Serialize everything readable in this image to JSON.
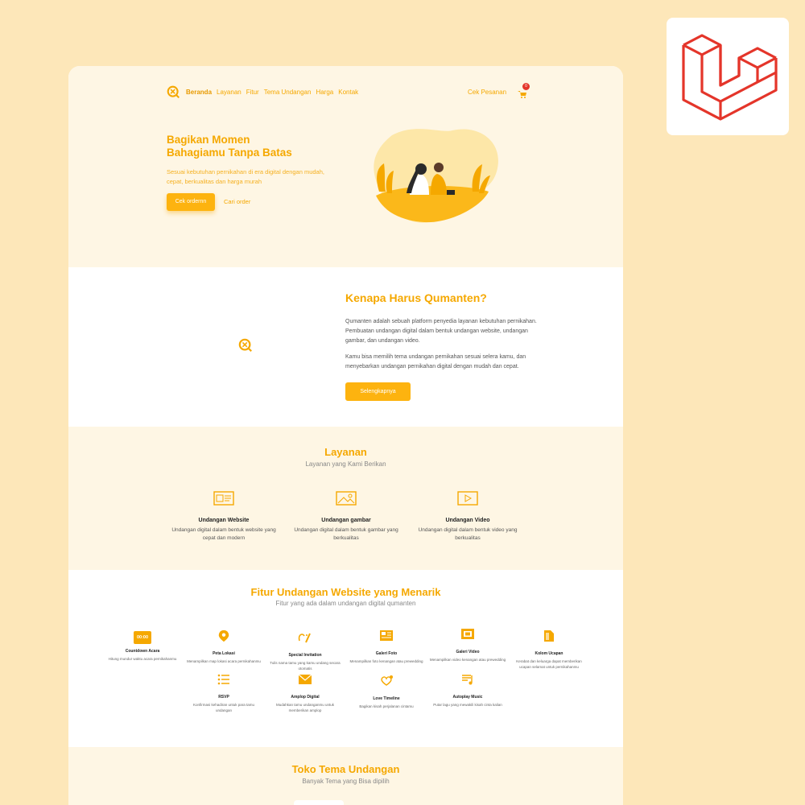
{
  "nav": {
    "items": [
      {
        "label": "Beranda",
        "active": true
      },
      {
        "label": "Layanan"
      },
      {
        "label": "Fitur"
      },
      {
        "label": "Tema Undangan"
      },
      {
        "label": "Harga"
      },
      {
        "label": "Kontak"
      }
    ],
    "cek_pesanan": "Cek Pesanan",
    "cart_count": "0"
  },
  "hero": {
    "title_line1": "Bagikan Momen",
    "title_line2": "Bahagiamu Tanpa Batas",
    "description": "Sesuai kebutuhan pernikahan di era digital dengan mudah, cepat, berkualitas dan harga murah",
    "primary_button": "Cek ordernn",
    "secondary_link": "Cari order"
  },
  "why": {
    "title": "Kenapa Harus Qumanten?",
    "paragraph1": "Qumanten adalah sebuah platform penyedia layanan kebutuhan pernikahan. Pembuatan undangan digital dalam bentuk undangan website, undangan gambar, dan undangan video.",
    "paragraph2": "Kamu bisa memilih tema undangan pernikahan sesuai selera kamu, dan menyebarkan undangan pernikahan digital dengan mudah dan cepat.",
    "button": "Selengkapnya"
  },
  "services": {
    "title": "Layanan",
    "subtitle": "Layanan yang Kami Berikan",
    "items": [
      {
        "title": "Undangan Website",
        "desc": "Undangan digital dalam bentuk website yang cepat dan modern",
        "icon": "website-icon"
      },
      {
        "title": "Undangan gambar",
        "desc": "Undangan digital dalam bentuk gambar yang berkualitas",
        "icon": "image-icon"
      },
      {
        "title": "Undangan Video",
        "desc": "Undangan digital dalam bentuk video yang berkualitas",
        "icon": "video-icon"
      }
    ]
  },
  "features": {
    "title": "Fitur Undangan Website yang Menarik",
    "subtitle": "Fitur yang ada dalam undangan digital qumanten",
    "items": [
      {
        "title": "Countdown Acara",
        "desc": "Hitung mundur waktu acara pernikahanmu",
        "icon": "countdown-icon",
        "glyph": "00:00"
      },
      {
        "title": "Peta Lokasi",
        "desc": "Menampilkan map lokasi acara pernikahanmu",
        "icon": "map-pin-icon"
      },
      {
        "title": "Special Invitation",
        "desc": "Tulis nama tamu yang kamu undang secara otomatis",
        "icon": "special-invitation-icon"
      },
      {
        "title": "Galeri Foto",
        "desc": "Menampilkan foto kenangan atau prewedding",
        "icon": "photo-gallery-icon"
      },
      {
        "title": "Galeri Video",
        "desc": "Menampilkan video kenangan atau prewedding",
        "icon": "video-gallery-icon"
      },
      {
        "title": "Kolom Ucapan",
        "desc": "Kerabat dan keluarga dapat memberikan ucapan selamat untuk pernikahanmu",
        "icon": "greeting-icon"
      },
      {
        "title": "RSVP",
        "desc": "Konfirmasi kehadiran untuk para tamu undangan",
        "icon": "rsvp-list-icon"
      },
      {
        "title": "Amplop Digital",
        "desc": "Mudahkan tamu undanganmu untuk memberikan amplop",
        "icon": "envelope-icon"
      },
      {
        "title": "Love Timeline",
        "desc": "Bagikan kisah perjalanan cintamu",
        "icon": "love-timeline-icon"
      },
      {
        "title": "Autoplay Music",
        "desc": "Putar lagu yang mewakili kisah cinta kalian",
        "icon": "music-icon"
      }
    ]
  },
  "toko": {
    "title": "Toko Tema Undangan",
    "subtitle": "Banyak Tema yang Bisa dipilih"
  },
  "colors": {
    "accent": "#f5a800",
    "button": "#fdb30f",
    "page_bg": "#fde7b9",
    "section_bg": "#fef6e4",
    "laravel_red": "#e4352a"
  }
}
